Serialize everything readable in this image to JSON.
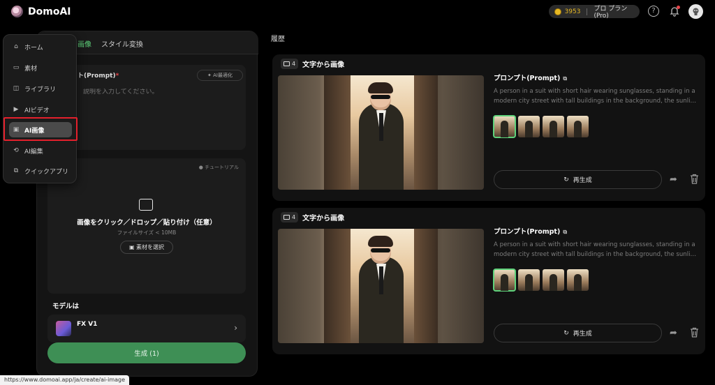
{
  "app": {
    "name": "DomoAI"
  },
  "header": {
    "credits": "3953",
    "plan": "プロ プラン(Pro)"
  },
  "tabs": {
    "active_fragment": "る画像",
    "style": "スタイル変換"
  },
  "prompt": {
    "label": "ト(Prompt)",
    "required_mark": "*",
    "optimize_label": "AI最適化",
    "placeholder": "説明を入力してください。"
  },
  "upload": {
    "tutorial_label": "チュートリアル",
    "main_text": "画像をクリック／ドロップ／貼り付け（任意）",
    "sub_text": "ファイルサイズ < 10MB",
    "select_material_label": "素材を選択"
  },
  "model": {
    "section_label": "モデルは",
    "name": "FX V1",
    "sub": ""
  },
  "generate": {
    "label": "生成 (1)"
  },
  "nav": {
    "items": [
      {
        "label": "ホーム",
        "icon": "home-icon"
      },
      {
        "label": "素材",
        "icon": "folder-icon"
      },
      {
        "label": "ライブラリ",
        "icon": "library-icon"
      },
      {
        "label": "AIビデオ",
        "icon": "video-icon"
      },
      {
        "label": "AI画像",
        "icon": "image-icon",
        "active": true
      },
      {
        "label": "AI編集",
        "icon": "edit-icon"
      },
      {
        "label": "クイックアプリ",
        "icon": "apps-icon"
      }
    ]
  },
  "status_url": "https://www.domoai.app/ja/create/ai-image",
  "history": {
    "title": "履歴",
    "cards": [
      {
        "count": "4",
        "title": "文字から画像",
        "prompt_title": "プロンプト(Prompt)",
        "prompt_lines": [
          "A person in a suit with short hair wearing sunglasses, standing in a",
          "modern city street with tall buildings in the background, the sunligh..."
        ],
        "regen_label": "再生成"
      },
      {
        "count": "4",
        "title": "文字から画像",
        "prompt_title": "プロンプト(Prompt)",
        "prompt_lines": [
          "A person in a suit with short hair wearing sunglasses, standing in a",
          "modern city street with tall buildings in the background, the sunligh..."
        ],
        "regen_label": "再生成"
      }
    ]
  },
  "colors": {
    "accent": "#5fd27b",
    "generate": "#3e8f55",
    "highlight": "#e5202c",
    "coin": "#e8b923"
  }
}
